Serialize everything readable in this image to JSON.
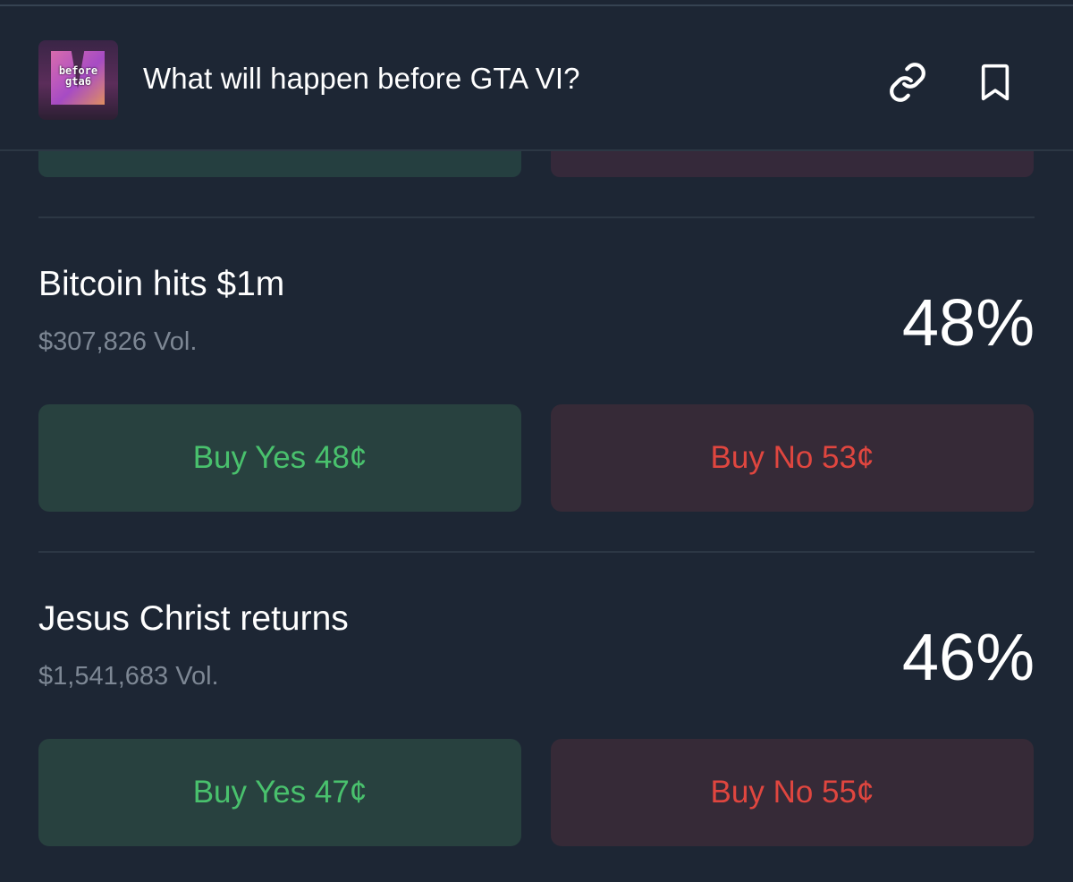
{
  "header": {
    "title": "What will happen before GTA VI?",
    "thumbnail_text": "before\ngta6",
    "actions": [
      {
        "icon": "link-icon"
      },
      {
        "icon": "bookmark-icon"
      }
    ]
  },
  "colors": {
    "background": "#1d2634",
    "yes_button_bg": "#28413f",
    "yes_text": "#49c16d",
    "no_button_bg": "#362a37",
    "no_text": "#e0463f",
    "muted_text": "#7d8794",
    "divider": "#2c3744"
  },
  "markets": [
    {
      "title": "Bitcoin hits $1m",
      "volume": "$307,826 Vol.",
      "probability": "48%",
      "buy_yes": "Buy Yes 48¢",
      "buy_no": "Buy No 53¢"
    },
    {
      "title": "Jesus Christ returns",
      "volume": "$1,541,683 Vol.",
      "probability": "46%",
      "buy_yes": "Buy Yes 47¢",
      "buy_no": "Buy No 55¢"
    }
  ]
}
